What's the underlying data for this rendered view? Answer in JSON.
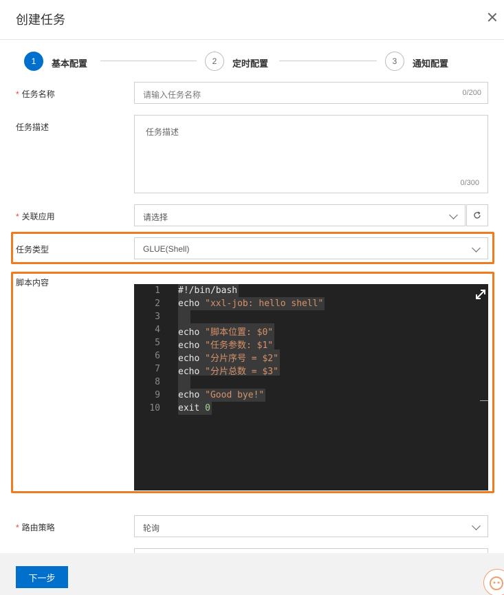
{
  "dialog": {
    "title": "创建任务"
  },
  "steps": [
    {
      "number": "1",
      "label": "基本配置"
    },
    {
      "number": "2",
      "label": "定时配置"
    },
    {
      "number": "3",
      "label": "通知配置"
    }
  ],
  "form": {
    "task_name": {
      "label": "任务名称",
      "placeholder": "请输入任务名称",
      "count": "0/200"
    },
    "task_desc": {
      "label": "任务描述",
      "placeholder": "任务描述",
      "count": "0/300"
    },
    "app": {
      "label": "关联应用",
      "value": "请选择"
    },
    "task_type": {
      "label": "任务类型",
      "value": "GLUE(Shell)"
    },
    "script": {
      "label": "脚本内容"
    },
    "routing": {
      "label": "路由策略",
      "value": "轮询"
    }
  },
  "required_mark": "*",
  "editor": {
    "lines": [
      {
        "no": "1",
        "parts": [
          {
            "t": "kw",
            "v": "#!/bin/bash"
          }
        ]
      },
      {
        "no": "2",
        "parts": [
          {
            "t": "kw",
            "v": "echo "
          },
          {
            "t": "str",
            "v": "\"xxl-job: hello shell\""
          }
        ]
      },
      {
        "no": "3",
        "parts": [
          {
            "t": "kw",
            "v": "  "
          }
        ]
      },
      {
        "no": "4",
        "parts": [
          {
            "t": "kw",
            "v": "echo "
          },
          {
            "t": "str",
            "v": "\"脚本位置: $0\""
          }
        ]
      },
      {
        "no": "5",
        "parts": [
          {
            "t": "kw",
            "v": "echo "
          },
          {
            "t": "str",
            "v": "\"任务参数: $1\""
          }
        ]
      },
      {
        "no": "6",
        "parts": [
          {
            "t": "kw",
            "v": "echo "
          },
          {
            "t": "str",
            "v": "\"分片序号 = $2\""
          }
        ]
      },
      {
        "no": "7",
        "parts": [
          {
            "t": "kw",
            "v": "echo "
          },
          {
            "t": "str",
            "v": "\"分片总数 = $3\""
          }
        ]
      },
      {
        "no": "8",
        "parts": [
          {
            "t": "kw",
            "v": "  "
          }
        ]
      },
      {
        "no": "9",
        "parts": [
          {
            "t": "kw",
            "v": "echo "
          },
          {
            "t": "str",
            "v": "\"Good bye!\""
          }
        ]
      },
      {
        "no": "10",
        "parts": [
          {
            "t": "kw",
            "v": "exit "
          },
          {
            "t": "num",
            "v": "0"
          }
        ]
      }
    ]
  },
  "footer": {
    "next_label": "下一步"
  },
  "colors": {
    "primary": "#0070cc",
    "highlight": "#f07a1e",
    "required": "#e04a3f",
    "editor_bg": "#222222"
  }
}
